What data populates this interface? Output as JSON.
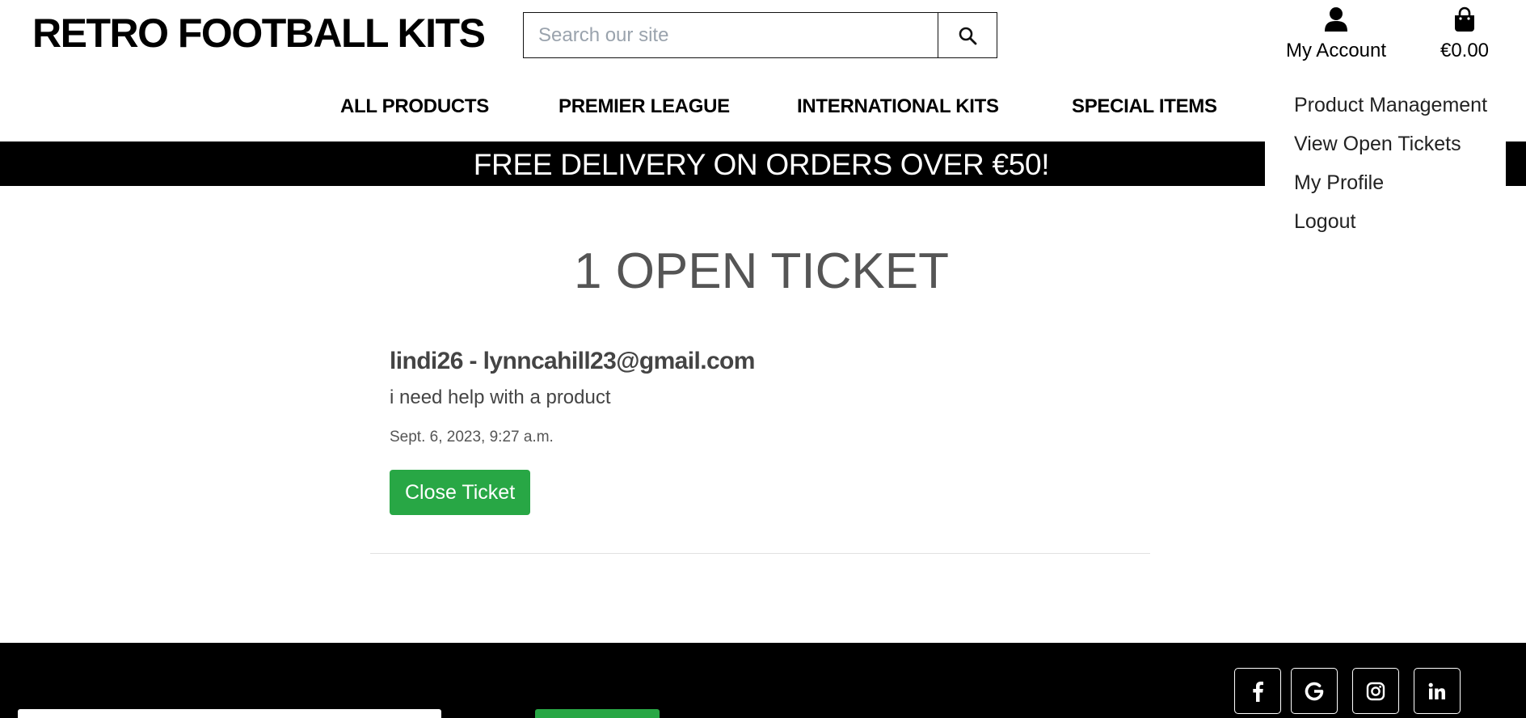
{
  "header": {
    "logo": "RETRO FOOTBALL KITS",
    "search_placeholder": "Search our site",
    "account_label": "My Account",
    "bag_total": "€0.00"
  },
  "nav": {
    "items": [
      "ALL PRODUCTS",
      "PREMIER LEAGUE",
      "INTERNATIONAL KITS",
      "SPECIAL ITEMS"
    ]
  },
  "banner": {
    "text": "FREE DELIVERY ON ORDERS OVER €50!"
  },
  "account_menu": {
    "items": [
      "Product Management",
      "View Open Tickets",
      "My Profile",
      "Logout"
    ]
  },
  "page": {
    "title": "1 OPEN TICKET"
  },
  "tickets": [
    {
      "header": "lindi26 - lynncahill23@gmail.com",
      "message": "i need help with a product",
      "date": "Sept. 6, 2023, 9:27 a.m.",
      "action_label": "Close Ticket"
    }
  ],
  "footer": {
    "social_icons": [
      "facebook-icon",
      "google-icon",
      "instagram-icon",
      "linkedin-icon"
    ]
  },
  "colors": {
    "accent_green": "#28a745",
    "banner_bg": "#000000"
  }
}
